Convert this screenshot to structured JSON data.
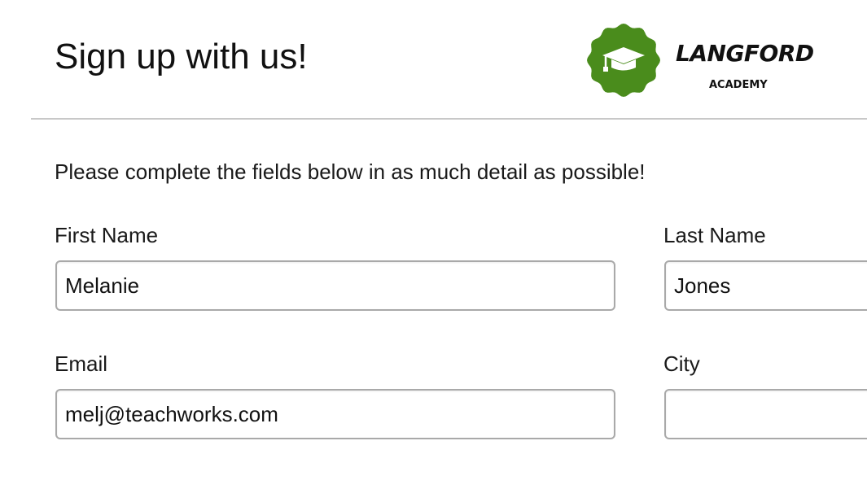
{
  "header": {
    "title": "Sign up with us!",
    "logo": {
      "name": "LANGFORD",
      "subtitle": "ACADEMY",
      "badge_color": "#4a8c1c",
      "icon": "graduation-cap-icon"
    }
  },
  "form": {
    "intro": "Please complete the fields below in as much detail as possible!",
    "first_name": {
      "label": "First Name",
      "value": "Melanie"
    },
    "last_name": {
      "label": "Last Name",
      "value": "Jones"
    },
    "email": {
      "label": "Email",
      "value": "melj@teachworks.com"
    },
    "city": {
      "label": "City",
      "value": ""
    }
  }
}
